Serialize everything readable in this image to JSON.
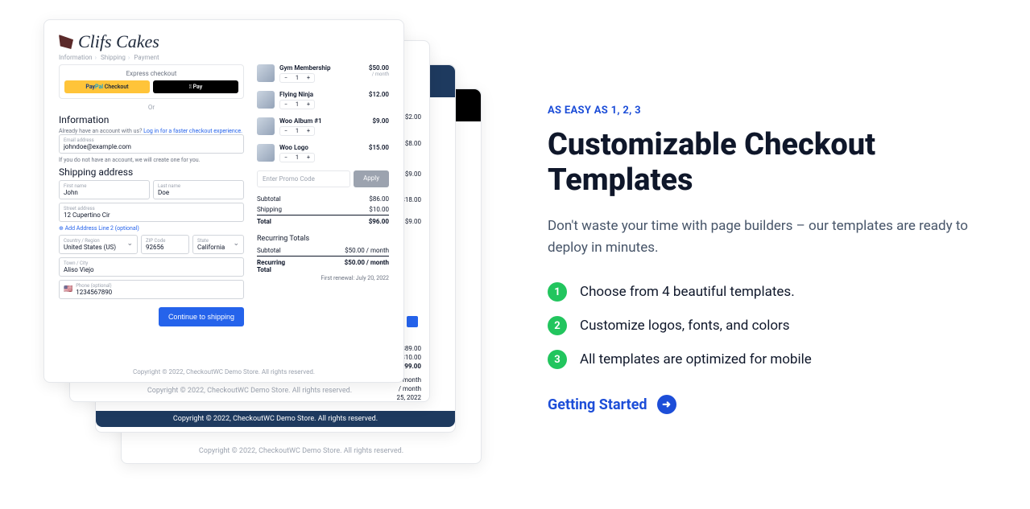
{
  "right": {
    "eyebrow": "AS EASY AS 1, 2, 3",
    "headline": "Customizable Checkout Templates",
    "lead": "Don't waste your time with page builders – our templates are ready to deploy in minutes.",
    "steps": [
      {
        "n": "1",
        "text": "Choose from 4 beautiful templates."
      },
      {
        "n": "2",
        "text": "Customize logos, fonts, and colors"
      },
      {
        "n": "3",
        "text": "All templates are optimized for mobile"
      }
    ],
    "cta": "Getting Started"
  },
  "ck": {
    "brand": "Clifs Cakes",
    "breadcrumbs": [
      "Information",
      "Shipping",
      "Payment"
    ],
    "express_title": "Express checkout",
    "paypal": {
      "p1": "Pay",
      "p2": "Pal",
      "p3": " Checkout"
    },
    "apple_pay": " Pay",
    "or": "Or",
    "info_heading": "Information",
    "acct_text": "Already have an account with us? ",
    "acct_link": "Log in for a faster checkout experience.",
    "email": {
      "label": "Email address",
      "value": "johndoe@example.com"
    },
    "no_acct": "If you do not have an account, we will create one for you.",
    "ship_heading": "Shipping address",
    "first": {
      "label": "First name",
      "value": "John"
    },
    "last": {
      "label": "Last name",
      "value": "Doe"
    },
    "street": {
      "label": "Street address",
      "value": "12 Cupertino Cir"
    },
    "add_line2": "Add Address Line 2 (optional)",
    "country": {
      "label": "Country / Region",
      "value": "United States (US)"
    },
    "zip": {
      "label": "ZIP Code",
      "value": "92656"
    },
    "state": {
      "label": "State",
      "value": "California"
    },
    "city": {
      "label": "Town / City",
      "value": "Aliso Viejo"
    },
    "phone": {
      "label": "Phone (optional)",
      "value": "1234567890",
      "flag": "🇺🇸"
    },
    "continue": "Continue to shipping",
    "cart": [
      {
        "name": "Gym Membership",
        "price": "$50.00",
        "sub": "/ month",
        "qty": "1"
      },
      {
        "name": "Flying Ninja",
        "price": "$12.00",
        "sub": "",
        "qty": "1"
      },
      {
        "name": "Woo Album #1",
        "price": "$9.00",
        "sub": "",
        "qty": "1"
      },
      {
        "name": "Woo Logo",
        "price": "$15.00",
        "sub": "",
        "qty": "1"
      }
    ],
    "promo_placeholder": "Enter Promo Code",
    "apply": "Apply",
    "subtotal": {
      "label": "Subtotal",
      "value": "$86.00"
    },
    "shipping": {
      "label": "Shipping",
      "value": "$10.00"
    },
    "total": {
      "label": "Total",
      "value": "$96.00"
    },
    "recurring_heading": "Recurring Totals",
    "r_sub": {
      "label": "Subtotal",
      "value": "$50.00 / month"
    },
    "r_total": {
      "label": "Recurring Total",
      "value": "$50.00 / month"
    },
    "renewal": "First renewal: July 20, 2022",
    "copyright": "Copyright © 2022, CheckoutWC Demo Store. All rights reserved."
  },
  "peek": {
    "prices": [
      "$2.00",
      "$8.00",
      "$9.00",
      "$18.00",
      "$9.00"
    ],
    "tail": [
      "$89.00",
      "$10.00",
      "$99.00",
      "/ month",
      "/ month",
      "25, 2022"
    ]
  }
}
